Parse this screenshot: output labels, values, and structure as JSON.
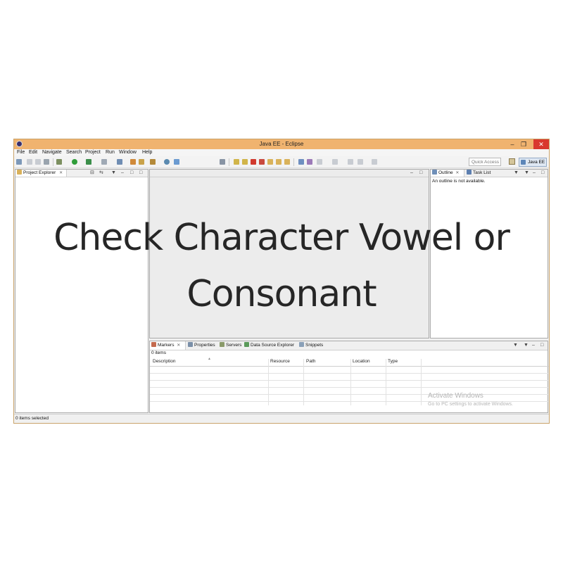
{
  "window": {
    "title": "Java EE - Eclipse"
  },
  "menu": [
    "File",
    "Edit",
    "Navigate",
    "Search",
    "Project",
    "Run",
    "Window",
    "Help"
  ],
  "toolbar": {
    "quick_access_placeholder": "Quick Access",
    "perspective_label": "Java EE"
  },
  "project_explorer": {
    "tab_label": "Project Explorer"
  },
  "outline": {
    "tab_label": "Outline",
    "tasklist_label": "Task List",
    "message": "An outline is not available."
  },
  "bottom": {
    "tabs": [
      {
        "label": "Markers",
        "icon": "markers-icon"
      },
      {
        "label": "Properties",
        "icon": "properties-icon"
      },
      {
        "label": "Servers",
        "icon": "servers-icon"
      },
      {
        "label": "Data Source Explorer",
        "icon": "data-source-icon"
      },
      {
        "label": "Snippets",
        "icon": "snippets-icon"
      }
    ],
    "items_count": "0 items",
    "columns": [
      "Description",
      "Resource",
      "Path",
      "Location",
      "Type"
    ]
  },
  "status": {
    "text": "0 items selected"
  },
  "watermark": {
    "line1": "Activate Windows",
    "line2": "Go to PC settings to activate Windows."
  },
  "overlay": {
    "line1": "Check Character Vowel or",
    "line2": "Consonant"
  },
  "colors": {
    "titlebar": "#f0b36f",
    "close": "#d9372e",
    "overlay_text": "#262626"
  }
}
